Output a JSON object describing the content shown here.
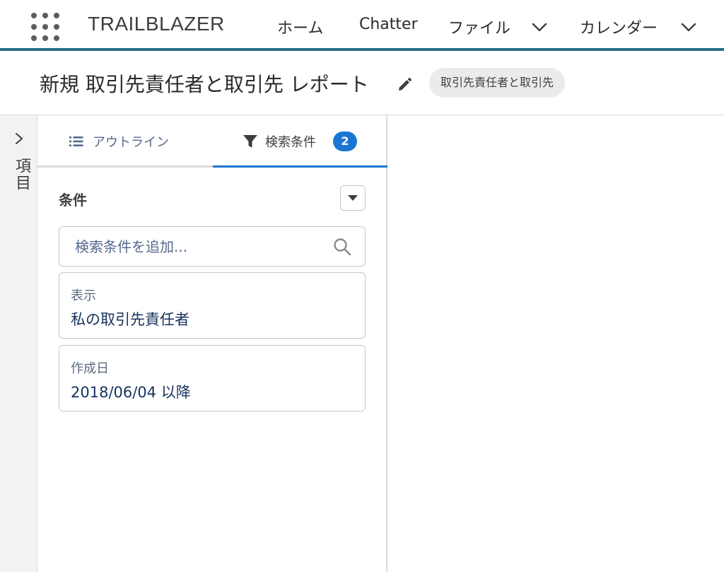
{
  "nav": {
    "app_name": "TRAILBLAZER",
    "items": [
      {
        "label": "ホーム"
      },
      {
        "label": "Chatter"
      },
      {
        "label": "ファイル"
      },
      {
        "label": "カレンダー"
      }
    ],
    "accent_color": "#2a6f86"
  },
  "report": {
    "title": "新規 取引先責任者と取引先 レポート",
    "type": "取引先責任者と取引先"
  },
  "fields_rail": {
    "label": "項目"
  },
  "panel": {
    "tabs": [
      {
        "label": "アウトライン",
        "icon": "list-icon"
      },
      {
        "label": "検索条件",
        "icon": "filter-icon",
        "count": "2",
        "active": true
      }
    ],
    "section_title": "条件",
    "search": {
      "placeholder": "検索条件を追加..."
    },
    "filters": [
      {
        "label": "表示",
        "value": "私の取引先責任者"
      },
      {
        "label": "作成日",
        "value": "2018/06/04 以降"
      }
    ]
  },
  "colors": {
    "brand_blue": "#1b76d3",
    "value_text": "#16325c"
  }
}
